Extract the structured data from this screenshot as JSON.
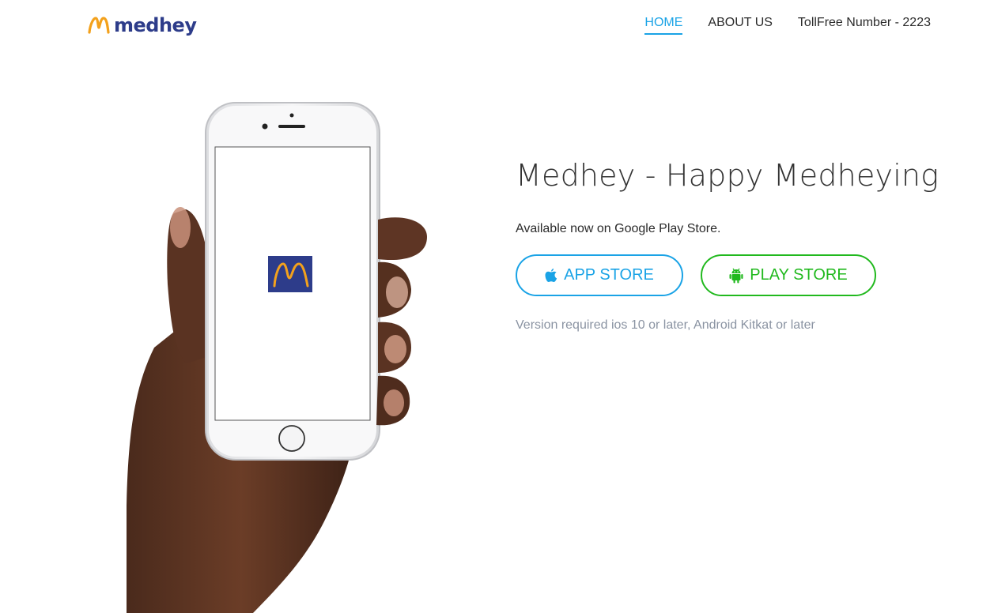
{
  "header": {
    "logo_text": "medhey",
    "nav": [
      {
        "label": "HOME",
        "active": true
      },
      {
        "label": "ABOUT US",
        "active": false
      },
      {
        "label": "TollFree Number - 2223",
        "active": false
      }
    ]
  },
  "hero": {
    "title": "Medhey - Happy Medheying",
    "subtitle": "Available now on Google Play Store.",
    "app_store_label": "APP STORE",
    "play_store_label": "PLAY STORE",
    "version_note": "Version required ios 10 or later, Android Kitkat or later"
  },
  "icons": {
    "logo": "medhey-m-logo-icon",
    "app_store": "apple-icon",
    "play_store": "android-icon",
    "phone_app": "medhey-app-icon"
  },
  "colors": {
    "brand_blue": "#2d3c8a",
    "brand_orange": "#f3a11c",
    "accent_blue": "#1aa3e6",
    "accent_green": "#21b91e",
    "muted_text": "#8a93a2"
  }
}
